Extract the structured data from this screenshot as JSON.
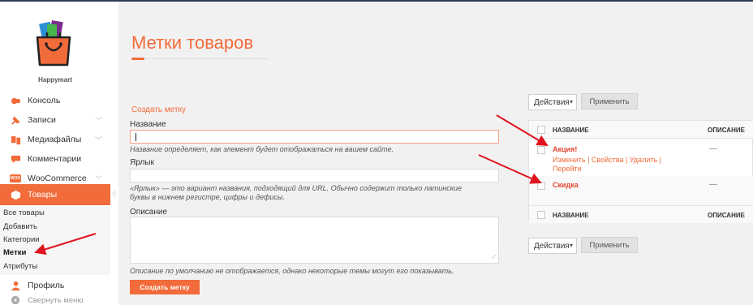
{
  "brand": {
    "name": "Happymart"
  },
  "sidebar": {
    "items": [
      {
        "label": "Консоль",
        "icon": "dashboard-icon"
      },
      {
        "label": "Записи",
        "icon": "pin-icon"
      },
      {
        "label": "Медиафайлы",
        "icon": "media-icon"
      },
      {
        "label": "Комментарии",
        "icon": "comment-icon"
      },
      {
        "label": "WooCommerce",
        "icon": "woo-icon",
        "badge": "WOO"
      },
      {
        "label": "Товары",
        "icon": "products-icon"
      }
    ],
    "submenu": [
      "Все товары",
      "Добавить",
      "Категории",
      "Метки",
      "Атрибуты"
    ],
    "bottom": [
      {
        "label": "Профиль",
        "icon": "user-icon"
      },
      {
        "label": "Свернуть меню",
        "icon": "collapse-icon"
      }
    ]
  },
  "page": {
    "title": "Метки товаров"
  },
  "form": {
    "heading": "Создать метку",
    "name_label": "Название",
    "name_hint": "Название определяет, как элемент будет отображаться на вашем сайте.",
    "slug_label": "Ярлык",
    "slug_hint_1": "«Ярлык» — это вариант названия, подходящий для URL. Обычно содержит только латинские",
    "slug_hint_2": "буквы в нижнем регистре, цифры и дефисы.",
    "desc_label": "Описание",
    "desc_hint": "Описание по умолчанию не отображается, однако некоторые темы могут его показывать.",
    "submit_label": "Создать метку"
  },
  "list": {
    "bulk_label": "Действия",
    "apply_label": "Применить",
    "col_name": "НАЗВАНИЕ",
    "col_desc": "ОПИСАНИЕ",
    "rows": [
      {
        "name": "Акция!",
        "desc": "—",
        "actions_1": "Изменить | Свойства | Удалить |",
        "actions_2": "Перейти"
      },
      {
        "name": "Скидка",
        "desc": "—"
      }
    ]
  },
  "colors": {
    "accent": "#f26b3a",
    "arrow": "#e0141e",
    "sidebar_active": "#f26b3a"
  }
}
